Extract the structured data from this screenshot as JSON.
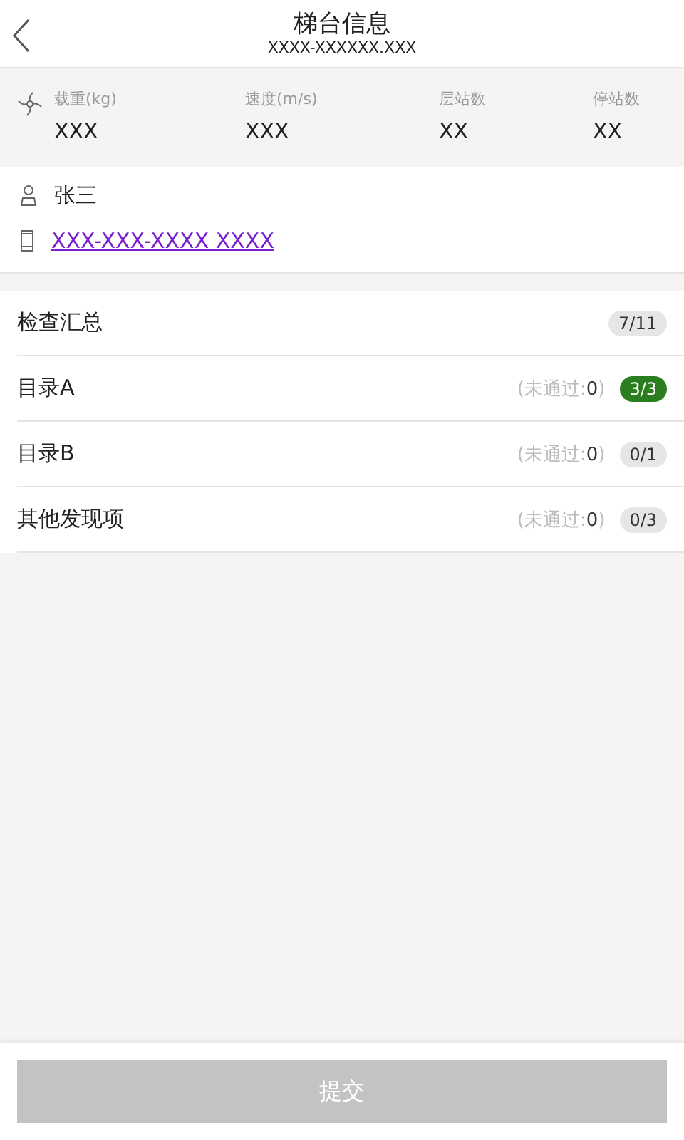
{
  "header": {
    "title": "梯台信息",
    "subtitle": "XXXX-XXXXXX.XXX"
  },
  "specs": [
    {
      "label": "载重(kg)",
      "value": "XXX"
    },
    {
      "label": "速度(m/s)",
      "value": "XXX"
    },
    {
      "label": "层站数",
      "value": "XX"
    },
    {
      "label": "停站数",
      "value": "XX"
    }
  ],
  "contact": {
    "name": "张三",
    "phone": "XXX-XXX-XXXX XXXX"
  },
  "summary": {
    "label": "检查汇总",
    "count": "7/11"
  },
  "sections": [
    {
      "label": "目录A",
      "failed_prefix": "(未通过:",
      "failed_count": "0",
      "failed_suffix": ")",
      "count": "3/3",
      "complete": true
    },
    {
      "label": "目录B",
      "failed_prefix": "(未通过:",
      "failed_count": "0",
      "failed_suffix": ")",
      "count": "0/1",
      "complete": false
    },
    {
      "label": "其他发现项",
      "failed_prefix": "(未通过:",
      "failed_count": "0",
      "failed_suffix": ")",
      "count": "0/3",
      "complete": false
    }
  ],
  "submit": {
    "label": "提交",
    "disabled": true
  }
}
